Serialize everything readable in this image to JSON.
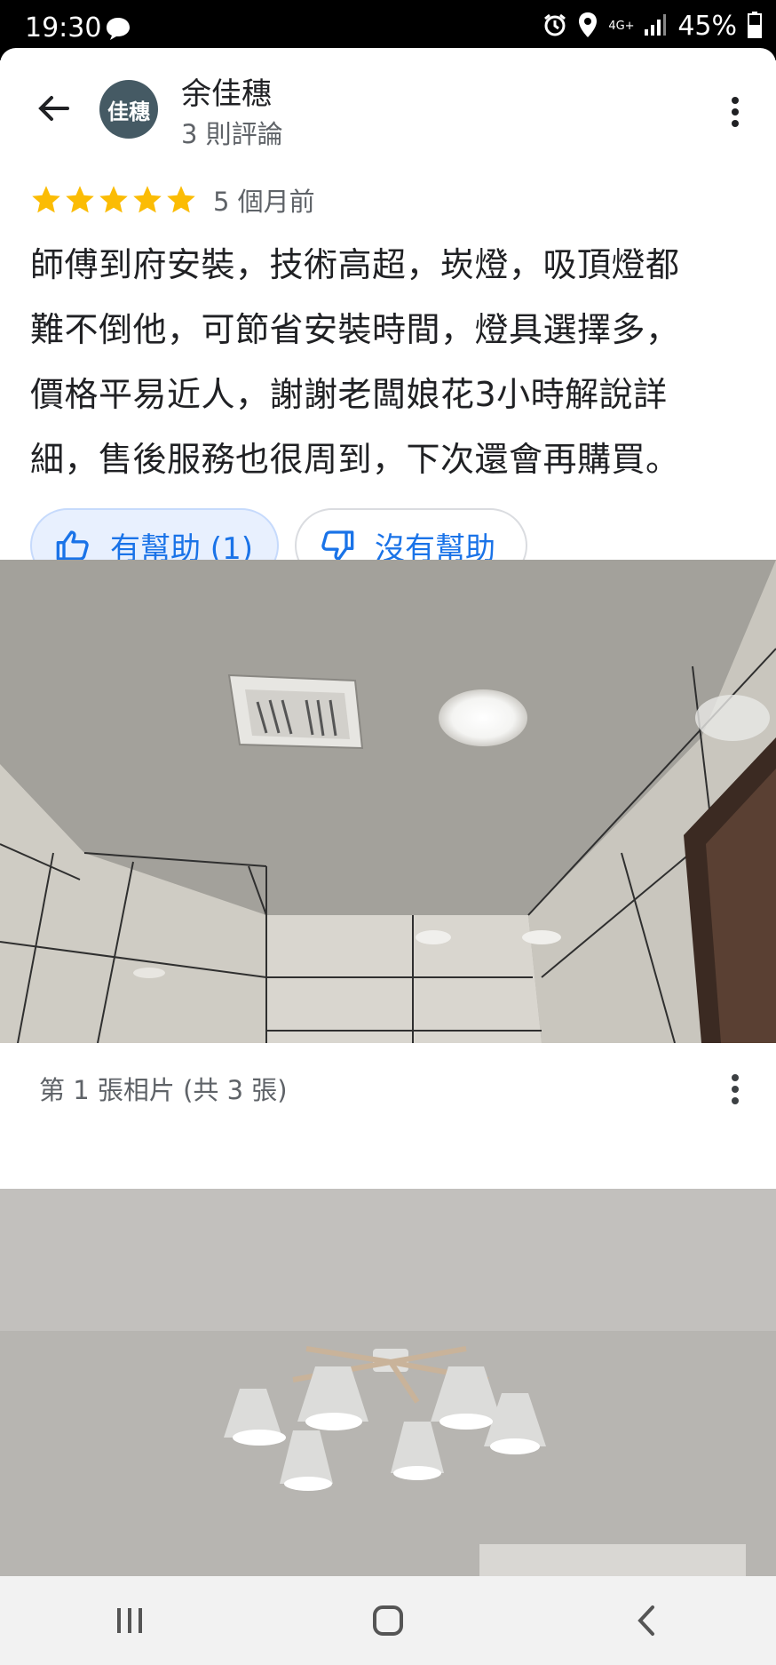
{
  "status_bar": {
    "time": "19:30",
    "network": "4G+",
    "battery": "45%"
  },
  "header": {
    "avatar_text": "佳穗",
    "avatar_color": "#455a64",
    "reviewer_name": "余佳穗",
    "review_count": "3 則評論"
  },
  "review": {
    "rating": 5,
    "time": "5 個月前",
    "text_lines": [
      "師傅到府安裝，技術高超，崁燈，吸頂燈都",
      "難不倒他，可節省安裝時間，燈具選擇多，",
      "價格平易近人，謝謝老闆娘花3小時解說詳",
      "細，售後服務也很周到，下次還會再購買。"
    ]
  },
  "actions": {
    "helpful_label": "有幫助 (1)",
    "not_helpful_label": "沒有幫助",
    "accent_color": "#1a73e8"
  },
  "photos": {
    "caption": "第 1 張相片 (共 3 張)"
  }
}
